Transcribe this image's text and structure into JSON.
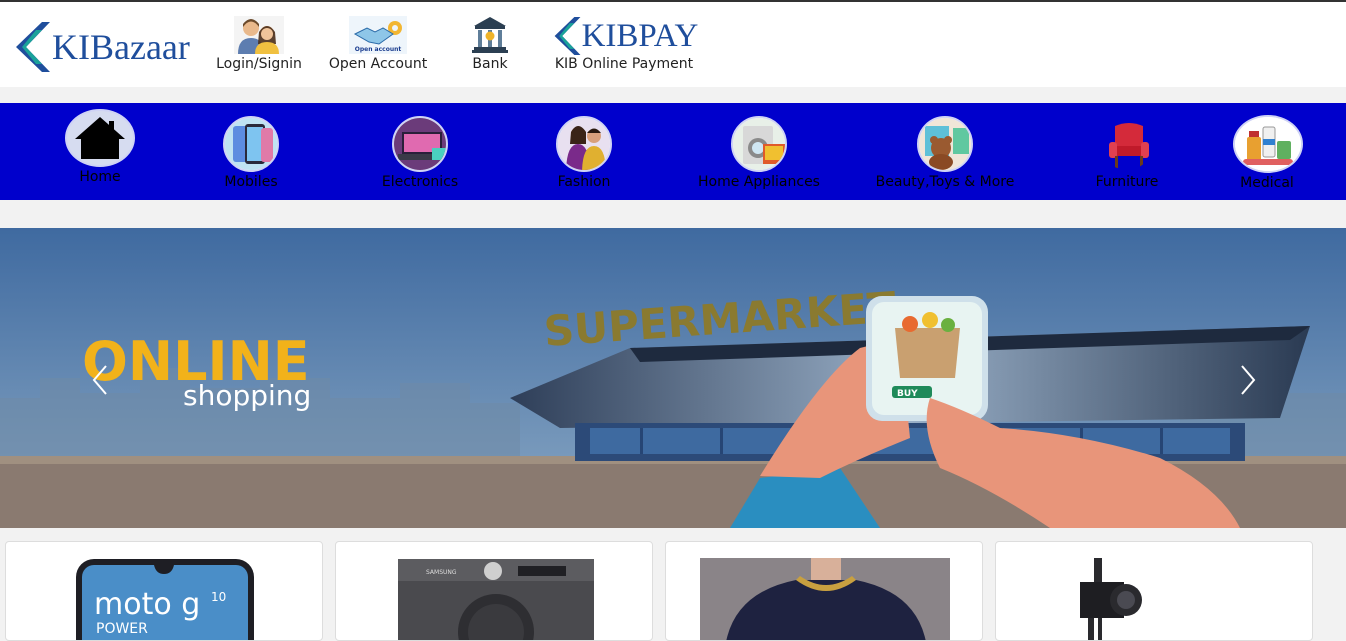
{
  "brand": {
    "logo_text": "KIBazaar",
    "pay_logo_text": "KIBPAY",
    "accent": "#1f4e9c"
  },
  "header": {
    "items": [
      {
        "label": "Login/Signin",
        "icon": "users-icon"
      },
      {
        "label": "Open Account",
        "icon": "handshake-icon",
        "icon_caption": "Open account"
      },
      {
        "label": "Bank",
        "icon": "bank-icon"
      },
      {
        "label": "KIB Online Payment",
        "icon": "kibpay-logo"
      }
    ]
  },
  "categories": {
    "bar_color": "#0000cc",
    "items": [
      {
        "label": "Home",
        "icon": "home-icon"
      },
      {
        "label": "Mobiles",
        "icon": "mobile-icon"
      },
      {
        "label": "Electronics",
        "icon": "laptop-icon"
      },
      {
        "label": "Fashion",
        "icon": "fashion-icon"
      },
      {
        "label": "Home Appliances",
        "icon": "washing-machine-icon"
      },
      {
        "label": "Beauty,Toys & More",
        "icon": "teddy-icon"
      },
      {
        "label": "Furniture",
        "icon": "chair-icon"
      },
      {
        "label": "Medical",
        "icon": "medicine-icon"
      }
    ]
  },
  "banner": {
    "headline": "ONLINE",
    "subline": "shopping",
    "store_sign": "SUPERMARKET",
    "buy_label": "BUY"
  },
  "products": [
    {
      "name": "moto g10 power",
      "screen_text": "moto g",
      "screen_sup": "10",
      "screen_sub": "POWER"
    },
    {
      "name": "washing machine",
      "brand_text": "SAMSUNG"
    },
    {
      "name": "t-shirt"
    },
    {
      "name": "camera"
    }
  ]
}
